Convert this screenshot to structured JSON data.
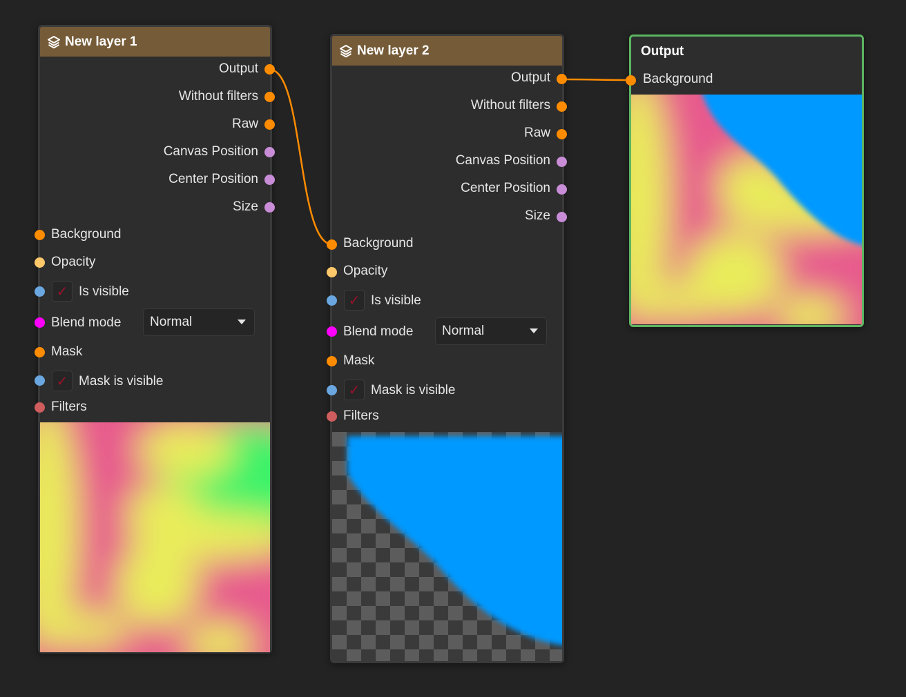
{
  "colors": {
    "image_socket": "#ff8c00",
    "float_socket": "#ffc96b",
    "bool_socket": "#6aa7e0",
    "blend_socket": "#ff00ff",
    "vector_socket": "#c98dd8",
    "filter_socket": "#cf5d5d",
    "header_brown": "#755b38",
    "output_border": "#5db562",
    "wire": "#ff8c00"
  },
  "nodes": [
    {
      "title": "New layer 1",
      "icon": "layers-icon",
      "outputs": [
        "Output",
        "Without filters",
        "Raw",
        "Canvas Position",
        "Center Position",
        "Size"
      ],
      "inputs": {
        "background": "Background",
        "opacity": "Opacity",
        "is_visible": "Is visible",
        "is_visible_checked": "✓",
        "blend_mode": "Blend mode",
        "blend_mode_value": "Normal",
        "mask": "Mask",
        "mask_is_visible": "Mask is visible",
        "mask_is_visible_checked": "✓",
        "filters": "Filters"
      }
    },
    {
      "title": "New layer 2",
      "icon": "layers-icon",
      "outputs": [
        "Output",
        "Without filters",
        "Raw",
        "Canvas Position",
        "Center Position",
        "Size"
      ],
      "inputs": {
        "background": "Background",
        "opacity": "Opacity",
        "is_visible": "Is visible",
        "is_visible_checked": "✓",
        "blend_mode": "Blend mode",
        "blend_mode_value": "Normal",
        "mask": "Mask",
        "mask_is_visible": "Mask is visible",
        "mask_is_visible_checked": "✓",
        "filters": "Filters"
      }
    }
  ],
  "output_node": {
    "title": "Output",
    "input": "Background"
  }
}
